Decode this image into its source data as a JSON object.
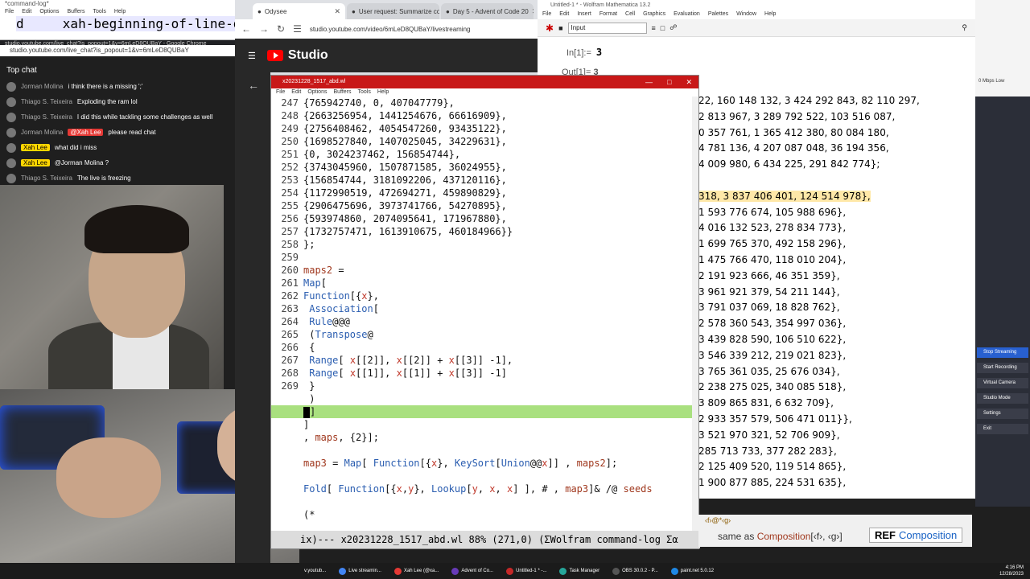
{
  "cmdlog": {
    "title": "*command-log*",
    "menu": [
      "File",
      "Edit",
      "Options",
      "Buffers",
      "Tools",
      "Help"
    ],
    "line": "d     xah-beginning-of-line-or"
  },
  "chat_window": {
    "title": "studio.youtube.com/live_chat?is_popout=1&v=6mLeD8QUBaY - Google Chrome",
    "url": "studio.youtube.com/live_chat?is_popout=1&v=6mLeD8QUBaY",
    "header": "Top chat",
    "messages": [
      {
        "author": "Jorman Molina",
        "text": "i think there is a missing ';'",
        "own": false,
        "mention": ""
      },
      {
        "author": "Thiago S. Teixeira",
        "text": "Exploding the ram lol",
        "own": false,
        "mention": ""
      },
      {
        "author": "Thiago S. Teixeira",
        "text": "I did this while tackling some challenges as well",
        "own": false,
        "mention": ""
      },
      {
        "author": "Jorman Molina",
        "text": "please read chat",
        "own": false,
        "mention": "@Xah Lee"
      },
      {
        "author": "Xah Lee",
        "text": "what did i miss",
        "own": true,
        "mention": ""
      },
      {
        "author": "Xah Lee",
        "text": "@Jorman Molina ?",
        "own": true,
        "mention": ""
      },
      {
        "author": "Thiago S. Teixeira",
        "text": "The live is freezing",
        "own": false,
        "mention": ""
      }
    ]
  },
  "browser": {
    "tabs": [
      {
        "label": "Odysee",
        "active": true
      },
      {
        "label": "User request: Summarize conv",
        "active": false
      },
      {
        "label": "Day 5 - Advent of Code 20",
        "active": false
      }
    ],
    "url": "studio.youtube.com/video/6mLeD8QUBaY/livestreaming",
    "studio_label": "Studio"
  },
  "emacs": {
    "title": "x20231228_1517_abd.wl",
    "menu": [
      "File",
      "Edit",
      "Options",
      "Buffers",
      "Tools",
      "Help"
    ],
    "lines": [
      {
        "n": "247",
        "code": "{765942740, 0, 407047779},"
      },
      {
        "n": "248",
        "code": "{2663256954, 1441254676, 66616909},"
      },
      {
        "n": "249",
        "code": "{2756408462, 4054547260, 93435122},"
      },
      {
        "n": "250",
        "code": "{1698527840, 1407025045, 34229631},"
      },
      {
        "n": "251",
        "code": "{0, 3024237462, 156854744},"
      },
      {
        "n": "252",
        "code": "{3743045960, 1507871585, 36024955},"
      },
      {
        "n": "253",
        "code": "{156854744, 3181092206, 437120116},"
      },
      {
        "n": "254",
        "code": "{1172990519, 472694271, 459890829},"
      },
      {
        "n": "255",
        "code": "{2906475696, 3973741766, 54270895},"
      },
      {
        "n": "256",
        "code": "{593974860, 2074095641, 171967880},"
      },
      {
        "n": "257",
        "code": "{1732757471, 1613910675, 460184966}}"
      },
      {
        "n": "258",
        "code": "};"
      },
      {
        "n": "259",
        "code": ""
      },
      {
        "n": "260",
        "code": "maps2 ="
      },
      {
        "n": "261",
        "code": "Map["
      },
      {
        "n": "262",
        "code": "Function[{x},"
      },
      {
        "n": "263",
        "code": " Association["
      },
      {
        "n": "264",
        "code": " Rule@@@"
      },
      {
        "n": "265",
        "code": " (Transpose@"
      },
      {
        "n": "266",
        "code": " {"
      },
      {
        "n": "267",
        "code": " Range[ x[[2]], x[[2]] + x[[3]] -1],"
      },
      {
        "n": "268",
        "code": " Range[ x[[1]], x[[1]] + x[[3]] -1]"
      },
      {
        "n": "269",
        "code": " }"
      },
      {
        "n": "",
        "code": " )"
      },
      {
        "n": "",
        "code": "]",
        "current": true
      },
      {
        "n": "",
        "code": "]"
      },
      {
        "n": "",
        "code": ", maps, {2}];"
      },
      {
        "n": "",
        "code": ""
      },
      {
        "n": "",
        "code": "map3 = Map[ Function[{x}, KeySort[Union@@x]] , maps2];"
      },
      {
        "n": "",
        "code": ""
      },
      {
        "n": "",
        "code": "Fold[ Function[{x,y}, Lookup[y, x, x] ], # , map3]& /@ seeds"
      },
      {
        "n": "",
        "code": ""
      },
      {
        "n": "",
        "code": "(*"
      }
    ],
    "modeline": "ix)--- x20231228_1517_abd.wl 88% (271,0) (ΣWolfram command-log Σα"
  },
  "mathematica": {
    "title": "Untitled-1 * - Wolfram Mathematica 13.2",
    "menu": [
      "File",
      "Edit",
      "Insert",
      "Format",
      "Cell",
      "Graphics",
      "Evaluation",
      "Palettes",
      "Window",
      "Help"
    ],
    "style_select": "Input",
    "in_label": "In[1]:=",
    "in_value": "3",
    "out_label": "Out[1]=",
    "out_value": "3",
    "rows": [
      "22, 160 148 132, 3 424 292 843, 82 110 297,",
      "2 813 967, 3 289 792 522, 103 516 087,",
      "0 357 761, 1 365 412 380, 80 084 180,",
      "4 781 136, 4 207 087 048, 36 194 356,",
      "4 009 980, 6 434 225, 291 842 774};",
      "",
      "318, 3 837 406 401, 124 514 978},",
      "1 593 776 674, 105 988 696},",
      "4 016 132 523, 278 834 773},",
      "1 699 765 370, 492 158 296},",
      "1 475 766 470, 118 010 204},",
      "2 191 923 666, 46 351 359},",
      "3 961 921 379, 54 211 144},",
      "3 791 037 069, 18 828 762},",
      "2 578 360 543, 354 997 036},",
      "3 439 828 590, 106 510 622},",
      "3 546 339 212, 219 021 823},",
      "3 765 361 035, 25 676 034},",
      "2 238 275 025, 340 085 518},",
      "3 809 865 831, 6 632 709},",
      "2 933 357 579, 506 471 011}},",
      "3 521 970 321, 52 706 909},",
      "285 713 733, 377 282 283},",
      "2 125 409 520, 119 514 865},",
      "1 900 877 885, 224 531 635},"
    ],
    "doc_template": "‹f›@*‹g›",
    "doc_same_as": "same as",
    "doc_fn": "Composition",
    "doc_args": "[‹f›, ‹g›]",
    "ref_label": "REF",
    "ref_link": "Composition"
  },
  "obs": {
    "net": "0 Mbps  Low",
    "buttons": [
      {
        "label": "Stop Streaming",
        "on": true
      },
      {
        "label": "Start Recording",
        "on": false
      },
      {
        "label": "Virtual Camera",
        "on": false
      },
      {
        "label": "Studio Mode",
        "on": false
      },
      {
        "label": "Settings",
        "on": false
      },
      {
        "label": "Exit",
        "on": false
      }
    ]
  },
  "taskbar": {
    "items": [
      {
        "label": "Live streamin...",
        "color": "#4285f4"
      },
      {
        "label": "Xah Lee (@xa...",
        "color": "#e53935"
      },
      {
        "label": "Advent of Co...",
        "color": "#673ab7"
      },
      {
        "label": "Untitled-1 * -...",
        "color": "#c62828"
      },
      {
        "label": "Task Manager",
        "color": "#26a69a"
      },
      {
        "label": "OBS 30.0.2 - P...",
        "color": "#555555"
      },
      {
        "label": "paint.net 5.0.12",
        "color": "#1e88e5"
      }
    ],
    "time": "4:16 PM",
    "date": "12/28/2023",
    "lang": "ENG US"
  }
}
